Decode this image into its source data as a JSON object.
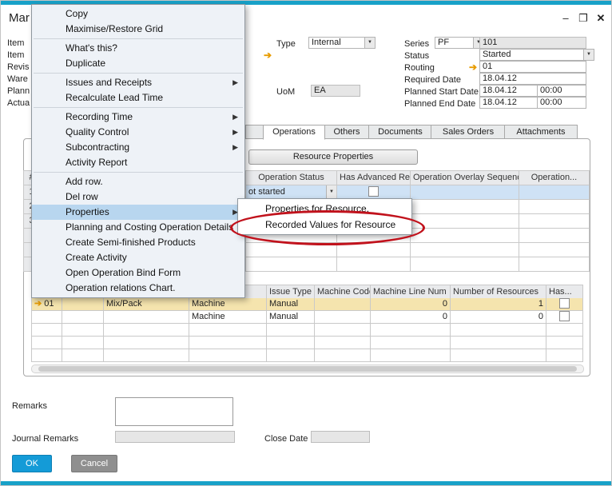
{
  "colors": {
    "accent_teal": "#18a1c8",
    "ok_blue": "#149bd7",
    "cancel_gray": "#8f8f8f",
    "menu_highlight": "#b8d6ef",
    "row_selected_blue": "#cfe2f5",
    "row_selected_gold": "#f5e4ae",
    "link_arrow_gold": "#e89c00",
    "annotation_red": "#c1121c"
  },
  "icons": {
    "minimize": "–",
    "maximize": "❐",
    "close": "✕",
    "submenu_arrow": "▶",
    "dropdown_arrow": "▼",
    "link_arrow": "➔"
  },
  "window": {
    "title": "Mar"
  },
  "header_fields": {
    "left_labels": [
      "Item",
      "Item",
      "Revis",
      "Ware",
      "Plann",
      "Actua"
    ],
    "type_label": "Type",
    "type_value": "Internal",
    "series_label": "Series",
    "series_value": "PF",
    "series_number": "101",
    "status_label": "Status",
    "status_value": "Started",
    "routing_label": "Routing",
    "routing_value": "01",
    "required_date_label": "Required Date",
    "required_date_value": "18.04.12",
    "planned_start_label": "Planned Start Date",
    "planned_start_date": "18.04.12",
    "planned_start_time": "00:00",
    "planned_end_label": "Planned End Date",
    "planned_end_date": "18.04.12",
    "planned_end_time": "00:00",
    "uom_label": "UoM",
    "uom_value": "EA"
  },
  "tabs": {
    "operations": "Operations",
    "others": "Others",
    "documents": "Documents",
    "sales_orders": "Sales Orders",
    "attachments": "Attachments"
  },
  "operations_section": {
    "resource_properties_button": "Resource Properties",
    "table": {
      "num_header": "#",
      "col_status": "Operation Status",
      "col_advanced": "Has Advanced Relation",
      "col_overlay": "Operation Overlay Sequence",
      "col_operation": "Operation...",
      "row_numbers": [
        "1",
        "2",
        "3"
      ],
      "row1_status_value": "ot started"
    }
  },
  "resources_table": {
    "col_issue_type": "Issue Type",
    "col_machine_code": "Machine Code",
    "col_machine_line_num": "Machine Line Num",
    "col_number_of_resources": "Number of Resources",
    "col_has": "Has...",
    "rows": [
      {
        "code": "01",
        "name": "Mix/Pack",
        "type": "Machine",
        "issue_type": "Manual",
        "machine_code": "",
        "machine_line_num": "0",
        "number_of_resources": "1"
      },
      {
        "code": "",
        "name": "",
        "type": "Machine",
        "issue_type": "Manual",
        "machine_code": "",
        "machine_line_num": "0",
        "number_of_resources": "0"
      }
    ]
  },
  "context_menu": {
    "items": [
      {
        "label": "Copy"
      },
      {
        "label": "Maximise/Restore Grid"
      },
      {
        "label": "What's this?"
      },
      {
        "label": "Duplicate"
      },
      {
        "label": "Issues and Receipts"
      },
      {
        "label": "Recalculate Lead Time"
      },
      {
        "label": "Recording Time"
      },
      {
        "label": "Quality Control"
      },
      {
        "label": "Subcontracting"
      },
      {
        "label": "Activity Report"
      },
      {
        "label": "Add row."
      },
      {
        "label": "Del row"
      },
      {
        "label": "Properties"
      },
      {
        "label": "Planning and Costing Operation Details"
      },
      {
        "label": "Create Semi-finished Products"
      },
      {
        "label": "Create Activity"
      },
      {
        "label": "Open Operation Bind Form"
      },
      {
        "label": "Operation relations Chart."
      }
    ]
  },
  "submenu": {
    "item1": "Properties for Resource.",
    "item2": "Recorded Values for Resource"
  },
  "footer": {
    "remarks_label": "Remarks",
    "journal_remarks_label": "Journal Remarks",
    "close_date_label": "Close Date",
    "ok_button": "OK",
    "cancel_button": "Cancel"
  }
}
